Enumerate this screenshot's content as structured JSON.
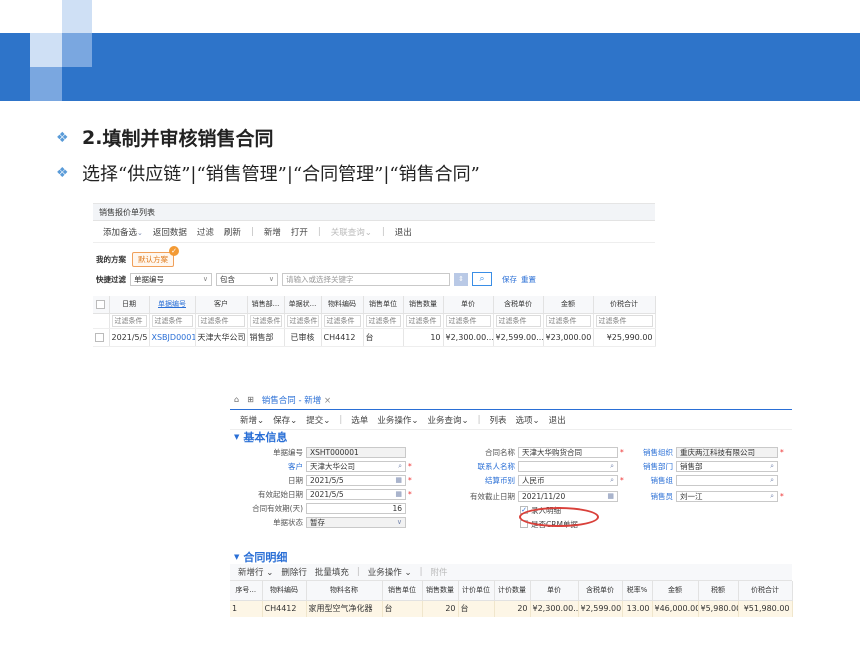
{
  "slide": {
    "heading_num": "2.",
    "heading_text": "填制并审核销售合同",
    "instruction": "选择“供应链”|“销售管理”|“合同管理”|“销售合同”",
    "bullet_icon": "diamond-bullet-icon",
    "colors": {
      "band": "#2e74c9",
      "bullet": "#5a9bd8",
      "link": "#2a6fd6",
      "highlight": "#d9403a"
    }
  },
  "quote_list": {
    "window_title": "销售报价单列表",
    "toolbar": [
      "添加备选",
      "返回数据",
      "过滤",
      "刷新",
      "新增",
      "打开",
      "关联查询",
      "退出"
    ],
    "scheme_label": "我的方案",
    "scheme_default": "默认方案",
    "quick_filter_label": "快捷过滤",
    "filter_field": "单据编号",
    "filter_op": "包含",
    "filter_placeholder": "请输入或选择关键字",
    "save_label": "保存",
    "reset_label": "重置",
    "columns": [
      "日期",
      "单据编号",
      "客户",
      "销售部...",
      "单据状...",
      "物料编码",
      "销售单位",
      "销售数量",
      "单价",
      "含税单价",
      "金额",
      "价税合计"
    ],
    "condition_text": "过滤条件",
    "row": [
      "2021/5/5",
      "XSBJD0001",
      "天津大华公司",
      "销售部",
      "已审核",
      "CH4412",
      "台",
      "10",
      "¥2,300.00...",
      "¥2,599.00...",
      "¥23,000.00",
      "¥25,990.00"
    ]
  },
  "contract": {
    "home_icon": "home-icon",
    "tab_title": "销售合同 - 新增",
    "toolbar": [
      "新增",
      "保存",
      "提交",
      "选单",
      "业务操作",
      "业务查询",
      "列表",
      "选项",
      "退出"
    ],
    "section_basic": "基本信息",
    "fields": {
      "doc_no_label": "单据编号",
      "doc_no": "XSHT000001",
      "customer_label": "客户",
      "customer": "天津大华公司",
      "date_label": "日期",
      "date": "2021/5/5",
      "start_label": "有效起始日期",
      "start": "2021/5/5",
      "valid_days_label": "合同有效期(天)",
      "valid_days": "16",
      "status_label": "单据状态",
      "status": "暂存",
      "name_label": "合同名称",
      "name": "天津大华购货合同",
      "contact_label": "联系人名称",
      "contact": "",
      "currency_label": "结算币别",
      "currency": "人民币",
      "end_label": "有效截止日期",
      "end": "2021/11/20",
      "detail_label": "录入明细",
      "crm_label": "是否CRM单据",
      "org_label": "销售组织",
      "org": "重庆两江科技有限公司",
      "dept_label": "销售部门",
      "dept": "销售部",
      "group_label": "销售组",
      "group": "",
      "salesman_label": "销售员",
      "salesman": "刘一江"
    },
    "section_detail": "合同明细",
    "detail_toolbar": [
      "新增行",
      "删除行",
      "批量填充",
      "业务操作",
      "附件"
    ],
    "columns": [
      "序号...",
      "物料编码",
      "物料名称",
      "销售单位",
      "销售数量",
      "计价单位",
      "计价数量",
      "单价",
      "含税单价",
      "税率%",
      "金额",
      "税额",
      "价税合计"
    ],
    "row": [
      "1",
      "CH4412",
      "家用型空气净化器",
      "台",
      "20",
      "台",
      "20",
      "¥2,300.00...",
      "¥2,599.00",
      "13.00",
      "¥46,000.00",
      "¥5,980.00",
      "¥51,980.00"
    ]
  }
}
